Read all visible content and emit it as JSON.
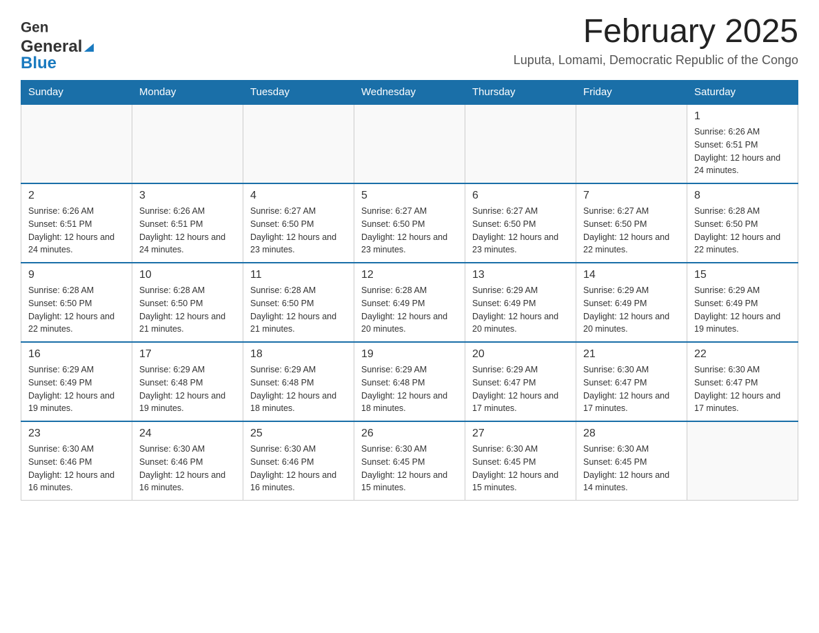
{
  "header": {
    "logo_general": "General",
    "logo_blue": "Blue",
    "title": "February 2025",
    "subtitle": "Luputa, Lomami, Democratic Republic of the Congo"
  },
  "days_of_week": [
    "Sunday",
    "Monday",
    "Tuesday",
    "Wednesday",
    "Thursday",
    "Friday",
    "Saturday"
  ],
  "weeks": [
    {
      "days": [
        {
          "num": "",
          "info": ""
        },
        {
          "num": "",
          "info": ""
        },
        {
          "num": "",
          "info": ""
        },
        {
          "num": "",
          "info": ""
        },
        {
          "num": "",
          "info": ""
        },
        {
          "num": "",
          "info": ""
        },
        {
          "num": "1",
          "info": "Sunrise: 6:26 AM\nSunset: 6:51 PM\nDaylight: 12 hours and 24 minutes."
        }
      ]
    },
    {
      "days": [
        {
          "num": "2",
          "info": "Sunrise: 6:26 AM\nSunset: 6:51 PM\nDaylight: 12 hours and 24 minutes."
        },
        {
          "num": "3",
          "info": "Sunrise: 6:26 AM\nSunset: 6:51 PM\nDaylight: 12 hours and 24 minutes."
        },
        {
          "num": "4",
          "info": "Sunrise: 6:27 AM\nSunset: 6:50 PM\nDaylight: 12 hours and 23 minutes."
        },
        {
          "num": "5",
          "info": "Sunrise: 6:27 AM\nSunset: 6:50 PM\nDaylight: 12 hours and 23 minutes."
        },
        {
          "num": "6",
          "info": "Sunrise: 6:27 AM\nSunset: 6:50 PM\nDaylight: 12 hours and 23 minutes."
        },
        {
          "num": "7",
          "info": "Sunrise: 6:27 AM\nSunset: 6:50 PM\nDaylight: 12 hours and 22 minutes."
        },
        {
          "num": "8",
          "info": "Sunrise: 6:28 AM\nSunset: 6:50 PM\nDaylight: 12 hours and 22 minutes."
        }
      ]
    },
    {
      "days": [
        {
          "num": "9",
          "info": "Sunrise: 6:28 AM\nSunset: 6:50 PM\nDaylight: 12 hours and 22 minutes."
        },
        {
          "num": "10",
          "info": "Sunrise: 6:28 AM\nSunset: 6:50 PM\nDaylight: 12 hours and 21 minutes."
        },
        {
          "num": "11",
          "info": "Sunrise: 6:28 AM\nSunset: 6:50 PM\nDaylight: 12 hours and 21 minutes."
        },
        {
          "num": "12",
          "info": "Sunrise: 6:28 AM\nSunset: 6:49 PM\nDaylight: 12 hours and 20 minutes."
        },
        {
          "num": "13",
          "info": "Sunrise: 6:29 AM\nSunset: 6:49 PM\nDaylight: 12 hours and 20 minutes."
        },
        {
          "num": "14",
          "info": "Sunrise: 6:29 AM\nSunset: 6:49 PM\nDaylight: 12 hours and 20 minutes."
        },
        {
          "num": "15",
          "info": "Sunrise: 6:29 AM\nSunset: 6:49 PM\nDaylight: 12 hours and 19 minutes."
        }
      ]
    },
    {
      "days": [
        {
          "num": "16",
          "info": "Sunrise: 6:29 AM\nSunset: 6:49 PM\nDaylight: 12 hours and 19 minutes."
        },
        {
          "num": "17",
          "info": "Sunrise: 6:29 AM\nSunset: 6:48 PM\nDaylight: 12 hours and 19 minutes."
        },
        {
          "num": "18",
          "info": "Sunrise: 6:29 AM\nSunset: 6:48 PM\nDaylight: 12 hours and 18 minutes."
        },
        {
          "num": "19",
          "info": "Sunrise: 6:29 AM\nSunset: 6:48 PM\nDaylight: 12 hours and 18 minutes."
        },
        {
          "num": "20",
          "info": "Sunrise: 6:29 AM\nSunset: 6:47 PM\nDaylight: 12 hours and 17 minutes."
        },
        {
          "num": "21",
          "info": "Sunrise: 6:30 AM\nSunset: 6:47 PM\nDaylight: 12 hours and 17 minutes."
        },
        {
          "num": "22",
          "info": "Sunrise: 6:30 AM\nSunset: 6:47 PM\nDaylight: 12 hours and 17 minutes."
        }
      ]
    },
    {
      "days": [
        {
          "num": "23",
          "info": "Sunrise: 6:30 AM\nSunset: 6:46 PM\nDaylight: 12 hours and 16 minutes."
        },
        {
          "num": "24",
          "info": "Sunrise: 6:30 AM\nSunset: 6:46 PM\nDaylight: 12 hours and 16 minutes."
        },
        {
          "num": "25",
          "info": "Sunrise: 6:30 AM\nSunset: 6:46 PM\nDaylight: 12 hours and 16 minutes."
        },
        {
          "num": "26",
          "info": "Sunrise: 6:30 AM\nSunset: 6:45 PM\nDaylight: 12 hours and 15 minutes."
        },
        {
          "num": "27",
          "info": "Sunrise: 6:30 AM\nSunset: 6:45 PM\nDaylight: 12 hours and 15 minutes."
        },
        {
          "num": "28",
          "info": "Sunrise: 6:30 AM\nSunset: 6:45 PM\nDaylight: 12 hours and 14 minutes."
        },
        {
          "num": "",
          "info": ""
        }
      ]
    }
  ]
}
